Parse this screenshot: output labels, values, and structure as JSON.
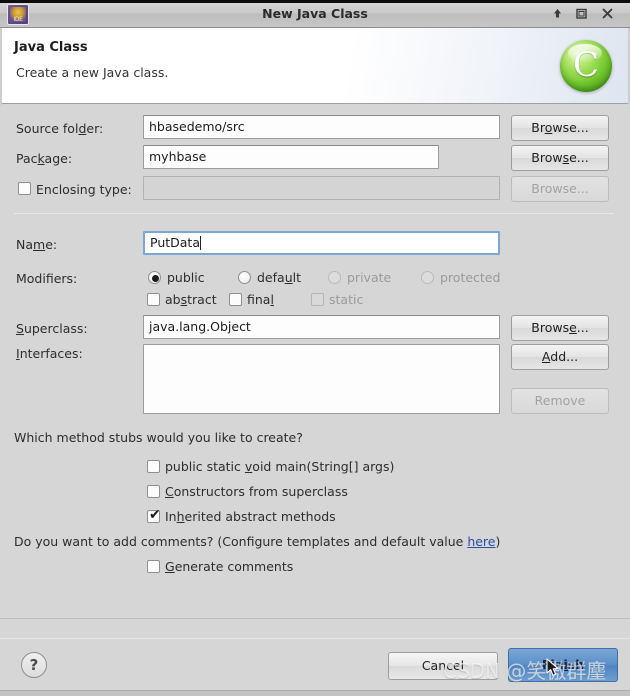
{
  "window": {
    "title": "New Java Class",
    "app_icon": "eclipse-ide-icon",
    "controls": {
      "shade": "shade-window",
      "maximize": "maximize-window",
      "close": "close-window"
    }
  },
  "banner": {
    "title": "Java Class",
    "description": "Create a new Java class.",
    "icon": "new-java-class-icon",
    "icon_letter": "C"
  },
  "form": {
    "source_folder": {
      "label_pre": "Source fol",
      "label_mnemonic": "d",
      "label_post": "er:",
      "value": "hbasedemo/src",
      "browse_pre": "Br",
      "browse_mnemonic": "o",
      "browse_post": "wse..."
    },
    "package": {
      "label_pre": "Pac",
      "label_mnemonic": "k",
      "label_post": "age:",
      "value": "myhbase",
      "browse_pre": "Brow",
      "browse_mnemonic": "s",
      "browse_post": "e..."
    },
    "enclosing_type": {
      "label": "Enclosing type:",
      "checked": false,
      "value": "",
      "disabled": true,
      "browse_label": "Browse..."
    },
    "name": {
      "label_pre": "Na",
      "label_mnemonic": "m",
      "label_post": "e:",
      "value": "PutData",
      "focused": true
    },
    "modifiers": {
      "label": "Modifiers:",
      "radios": [
        {
          "label": "public",
          "selected": true,
          "disabled": false,
          "mnemonic": ""
        },
        {
          "label_pre": "defa",
          "mnemonic": "u",
          "label_post": "lt",
          "label": "default",
          "selected": false,
          "disabled": false
        },
        {
          "label": "private",
          "selected": false,
          "disabled": true
        },
        {
          "label": "protected",
          "selected": false,
          "disabled": true
        }
      ],
      "checkboxes": [
        {
          "label_pre": "ab",
          "mnemonic": "s",
          "label_post": "tract",
          "label": "abstract",
          "checked": false,
          "disabled": false
        },
        {
          "label_pre": "fina",
          "mnemonic": "l",
          "label_post": "",
          "label": "final",
          "checked": false,
          "disabled": false
        },
        {
          "label": "static",
          "checked": false,
          "disabled": true
        }
      ]
    },
    "superclass": {
      "label_pre": "",
      "label_mnemonic": "S",
      "label_post": "uperclass:",
      "value": "java.lang.Object",
      "browse_pre": "Brows",
      "browse_mnemonic": "e",
      "browse_post": "..."
    },
    "interfaces": {
      "label_pre": "",
      "label_mnemonic": "I",
      "label_post": "nterfaces:",
      "items": [],
      "add_pre": "",
      "add_mnemonic": "A",
      "add_post": "dd...",
      "remove_label": "Remove",
      "remove_disabled": true
    }
  },
  "stubs": {
    "question": "Which method stubs would you like to create?",
    "items": [
      {
        "label_pre": "public static ",
        "mnemonic": "v",
        "label_post": "oid main(String[] args)",
        "label": "public static void main(String[] args)",
        "checked": false
      },
      {
        "label_pre": "",
        "mnemonic": "C",
        "label_post": "onstructors from superclass",
        "label": "Constructors from superclass",
        "checked": false
      },
      {
        "label_pre": "In",
        "mnemonic": "h",
        "label_post": "erited abstract methods",
        "label": "Inherited abstract methods",
        "checked": true
      }
    ]
  },
  "comments": {
    "question_pre": "Do you want to add comments? (Configure templates and default value ",
    "link": "here",
    "question_post": ")",
    "checkbox": {
      "label_pre": "",
      "mnemonic": "G",
      "label_post": "enerate comments",
      "label": "Generate comments",
      "checked": false
    }
  },
  "footer": {
    "help_label": "?",
    "cancel_label": "Cancel",
    "finish_pre": "Fin",
    "finish_mnemonic": "i",
    "finish_post": "sh"
  },
  "overlay": {
    "watermark": "CSDN @笑傲群麈",
    "cursor": "mouse-pointer"
  },
  "colors": {
    "dialog_bg": "#d6d6d6",
    "accent_button": "#5c8fc9",
    "link": "#2a4fa8",
    "banner_icon": "#74c72e"
  }
}
